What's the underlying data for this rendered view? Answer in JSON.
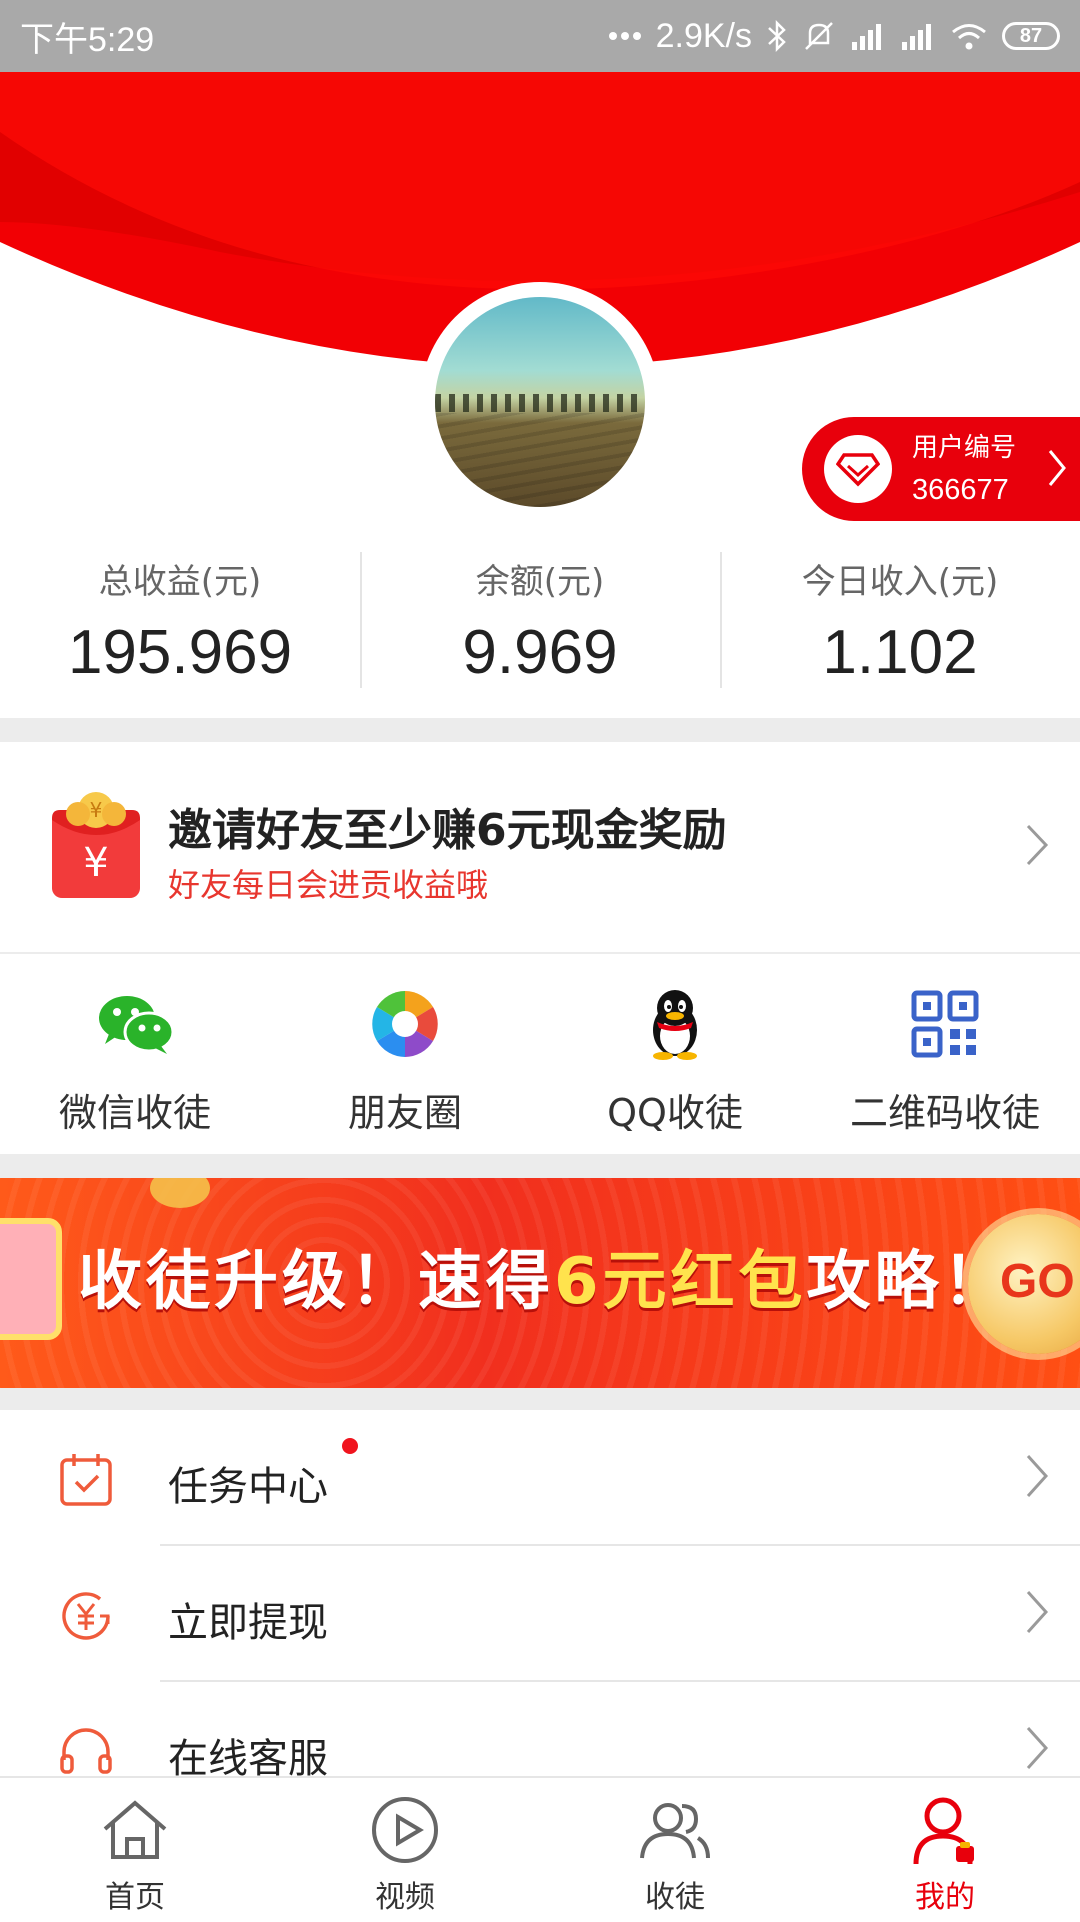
{
  "status_bar": {
    "time": "下午5:29",
    "network_speed": "2.9K/s",
    "battery": "87",
    "icons": [
      "more-dots-icon",
      "bluetooth-icon",
      "mute-icon",
      "signal-icon",
      "signal-icon",
      "wifi-icon",
      "battery-icon"
    ]
  },
  "colors": {
    "brand_red": "#e8000c",
    "accent_orange": "#e8362e",
    "divider": "#ececec"
  },
  "user": {
    "id_label": "用户编号",
    "id_value": "366677"
  },
  "stats": [
    {
      "label": "总收益(元)",
      "value": "195.969"
    },
    {
      "label": "余额(元)",
      "value": "9.969"
    },
    {
      "label": "今日收入(元)",
      "value": "1.102"
    }
  ],
  "invite": {
    "title": "邀请好友至少赚6元现金奖励",
    "subtitle": "好友每日会进贡收益哦"
  },
  "share": [
    {
      "label": "微信收徒",
      "icon": "wechat-icon"
    },
    {
      "label": "朋友圈",
      "icon": "moments-icon"
    },
    {
      "label": "QQ收徒",
      "icon": "qq-icon"
    },
    {
      "label": "二维码收徒",
      "icon": "qrcode-icon"
    }
  ],
  "banner": {
    "text_a": "收徒升级！速得",
    "text_b": "6元红包",
    "text_c": "攻略！",
    "go": "GO"
  },
  "menu": [
    {
      "label": "任务中心",
      "icon": "calendar-check-icon",
      "badge": true
    },
    {
      "label": "立即提现",
      "icon": "yuan-refresh-icon",
      "badge": false
    },
    {
      "label": "在线客服",
      "icon": "headset-icon",
      "badge": false
    }
  ],
  "nav": [
    {
      "label": "首页",
      "icon": "home-icon"
    },
    {
      "label": "视频",
      "icon": "play-icon"
    },
    {
      "label": "收徒",
      "icon": "users-icon"
    },
    {
      "label": "我的",
      "icon": "profile-icon",
      "active": true
    }
  ]
}
